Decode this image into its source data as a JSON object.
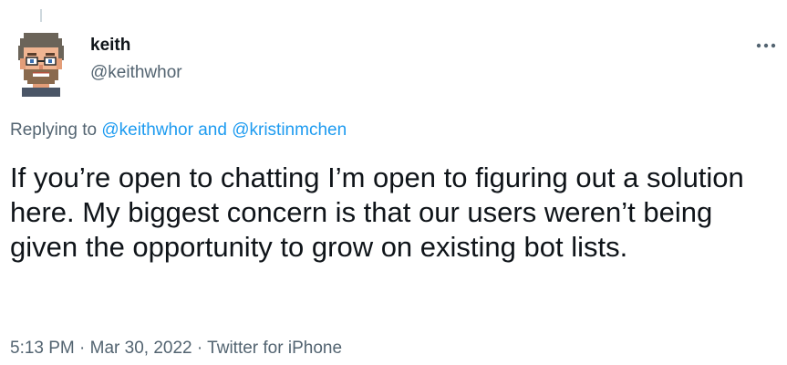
{
  "author": {
    "display_name": "keith",
    "handle": "@keithwhor"
  },
  "reply_context": {
    "prefix": "Replying to",
    "mention_1": "@keithwhor",
    "joiner": "and",
    "mention_2": "@kristinmchen"
  },
  "tweet": {
    "text": "If you’re open to chatting I’m open to figuring out a solution here. My biggest concern is that our users weren’t being given the opportunity to grow on existing bot lists."
  },
  "meta": {
    "time": "5:13 PM",
    "separator": "·",
    "date": "Mar 30, 2022",
    "source": "Twitter for iPhone"
  },
  "icons": {
    "more": "more-horizontal-icon",
    "avatar": "pixel-art-avatar"
  },
  "colors": {
    "accent": "#1d9bf0",
    "secondary_text": "#536471",
    "primary_text": "#0f1419"
  }
}
